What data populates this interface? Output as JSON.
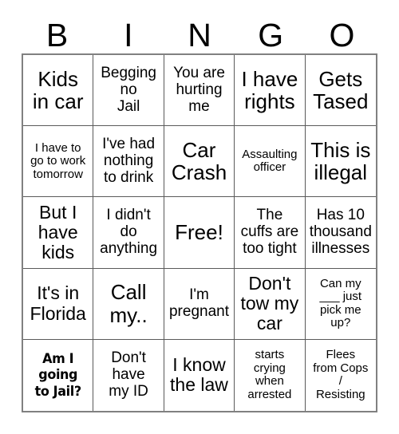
{
  "card": {
    "title": "BINGO",
    "header_letters": [
      "B",
      "I",
      "N",
      "G",
      "O"
    ],
    "colors": {
      "grid_outer_border": "#808080",
      "grid_inner_border": "#5a5a5a",
      "cell_background": "#ffffff",
      "text": "#000000",
      "page_background": "#ffffff"
    },
    "grid": {
      "columns": 5,
      "rows": 5,
      "free_space_index": 12
    },
    "cells": [
      {
        "text": "Kids\nin car",
        "size": "s-xl",
        "style": "normal"
      },
      {
        "text": "Begging\nno\nJail",
        "size": "s-md",
        "style": "normal"
      },
      {
        "text": "You are\nhurting\nme",
        "size": "s-md",
        "style": "normal"
      },
      {
        "text": "I have\nrights",
        "size": "s-xl",
        "style": "normal"
      },
      {
        "text": "Gets\nTased",
        "size": "s-xl",
        "style": "normal"
      },
      {
        "text": "I have to\ngo to work\ntomorrow",
        "size": "s-sm",
        "style": "normal"
      },
      {
        "text": "I've had\nnothing\nto drink",
        "size": "s-md",
        "style": "normal"
      },
      {
        "text": "Car\nCrash",
        "size": "s-xl",
        "style": "normal"
      },
      {
        "text": "Assaulting\nofficer",
        "size": "s-sm",
        "style": "normal"
      },
      {
        "text": "This is\nillegal",
        "size": "s-xl",
        "style": "normal"
      },
      {
        "text": "But I\nhave\nkids",
        "size": "s-lg",
        "style": "normal"
      },
      {
        "text": "I didn't\ndo\nanything",
        "size": "s-md",
        "style": "normal"
      },
      {
        "text": "Free!",
        "size": "s-xl",
        "style": "normal"
      },
      {
        "text": "The\ncuffs are\ntoo tight",
        "size": "s-md",
        "style": "normal"
      },
      {
        "text": "Has 10\nthousand\nillnesses",
        "size": "s-md",
        "style": "normal"
      },
      {
        "text": "It's in\nFlorida",
        "size": "s-lg",
        "style": "normal"
      },
      {
        "text": "Call\nmy..",
        "size": "s-xl",
        "style": "normal"
      },
      {
        "text": "I'm\npregnant",
        "size": "s-md",
        "style": "normal"
      },
      {
        "text": "Don't\ntow my\ncar",
        "size": "s-lg",
        "style": "normal"
      },
      {
        "text": "Can my\n___ just\npick me\nup?",
        "size": "s-sm",
        "style": "normal"
      },
      {
        "text": "Am I\ngoing\nto Jail?",
        "size": "s-md",
        "style": "bold-condensed"
      },
      {
        "text": "Don't\nhave\nmy ID",
        "size": "s-md",
        "style": "normal"
      },
      {
        "text": "I know\nthe law",
        "size": "s-lg",
        "style": "normal"
      },
      {
        "text": "starts\ncrying\nwhen\narrested",
        "size": "s-sm",
        "style": "normal"
      },
      {
        "text": "Flees\nfrom Cops\n/\nResisting",
        "size": "s-sm",
        "style": "normal"
      }
    ]
  }
}
